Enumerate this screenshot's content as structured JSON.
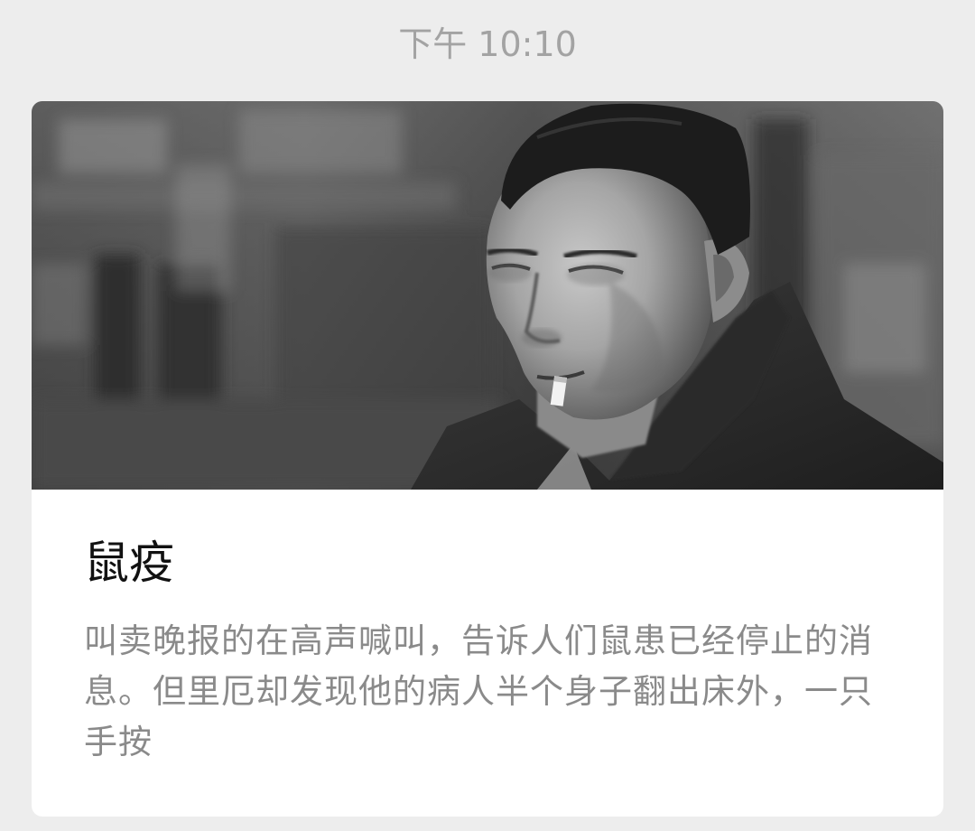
{
  "header": {
    "timestamp": "下午 10:10"
  },
  "article_card": {
    "title": "鼠疫",
    "summary": "叫卖晚报的在高声喊叫，告诉人们鼠患已经停止的消息。但里厄却发现他的病人半个身子翻出床外，一只手按",
    "cover_image": "black-and-white-portrait-photo"
  },
  "colors": {
    "background": "#ededed",
    "card": "#ffffff",
    "title": "#111111",
    "summary": "#8a8a8a",
    "timestamp": "#a3a3a3"
  }
}
